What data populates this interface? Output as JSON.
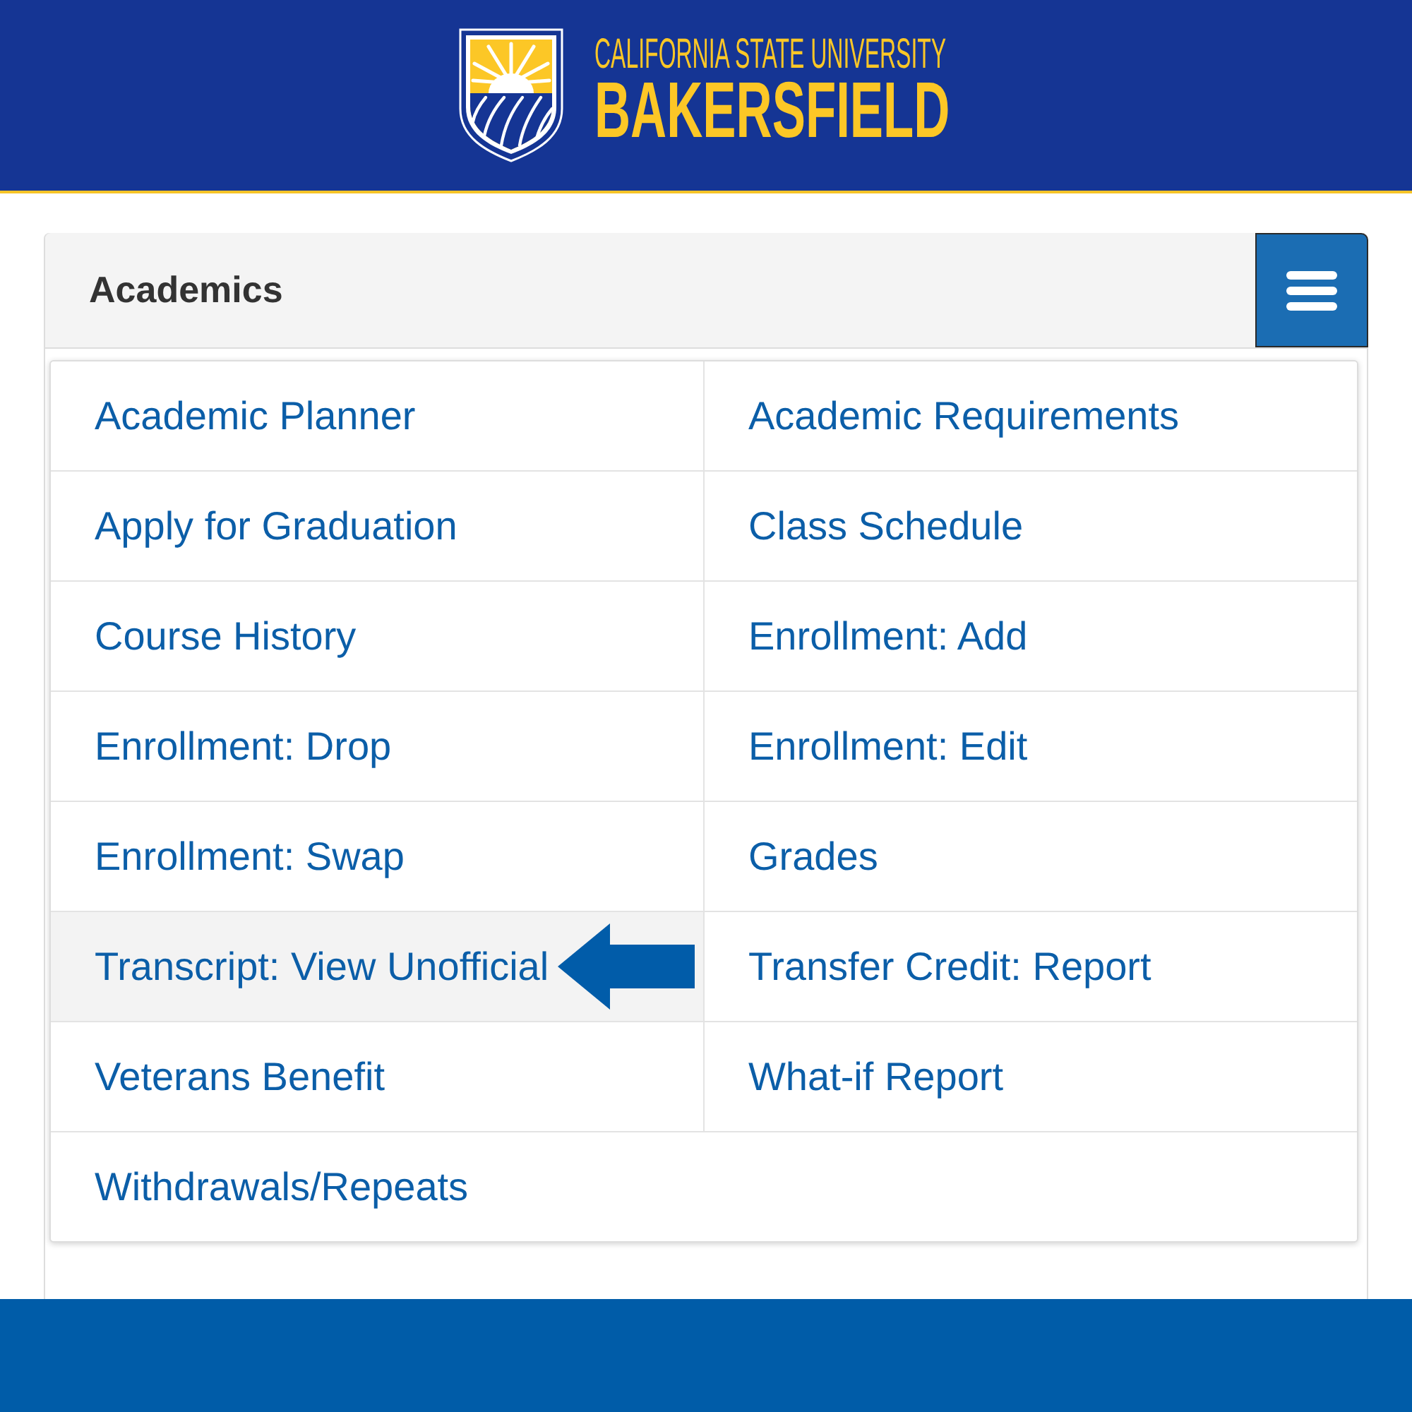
{
  "header": {
    "logo": {
      "line_1": "CALIFORNIA STATE UNIVERSITY",
      "line_2": "BAKERSFIELD"
    }
  },
  "panel": {
    "title": "Academics"
  },
  "menu": {
    "items": [
      {
        "label": "Academic Planner",
        "highlighted": false
      },
      {
        "label": "Academic Requirements",
        "highlighted": false
      },
      {
        "label": "Apply for Graduation",
        "highlighted": false
      },
      {
        "label": "Class Schedule",
        "highlighted": false
      },
      {
        "label": "Course History",
        "highlighted": false
      },
      {
        "label": "Enrollment: Add",
        "highlighted": false
      },
      {
        "label": "Enrollment: Drop",
        "highlighted": false
      },
      {
        "label": "Enrollment: Edit",
        "highlighted": false
      },
      {
        "label": "Enrollment: Swap",
        "highlighted": false
      },
      {
        "label": "Grades",
        "highlighted": false
      },
      {
        "label": "Transcript: View Unofficial",
        "highlighted": true
      },
      {
        "label": "Transfer Credit: Report",
        "highlighted": false
      },
      {
        "label": "Veterans Benefit",
        "highlighted": false
      },
      {
        "label": "What-if Report",
        "highlighted": false
      },
      {
        "label": "Withdrawals/Repeats",
        "highlighted": false
      }
    ]
  }
}
